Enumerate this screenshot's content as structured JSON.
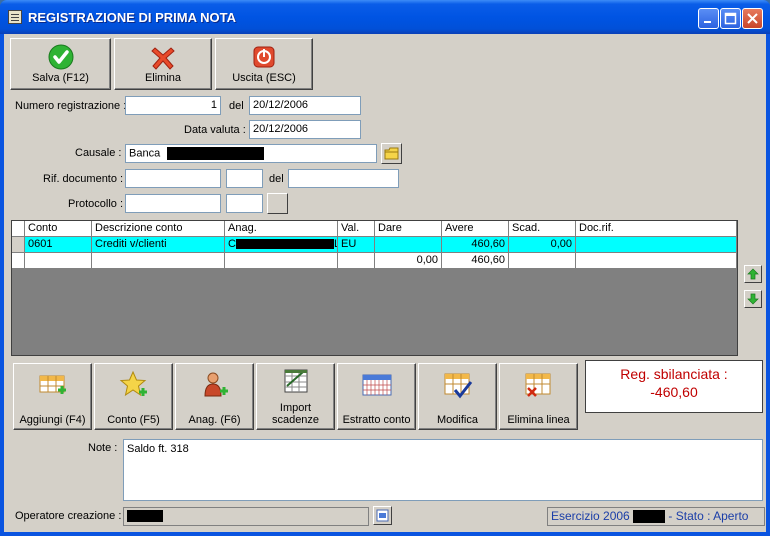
{
  "window": {
    "title": "REGISTRAZIONE DI PRIMA NOTA"
  },
  "toolbar": {
    "save_label": "Salva (F12)",
    "delete_label": "Elimina",
    "exit_label": "Uscita (ESC)"
  },
  "form": {
    "numero_label": "Numero registrazione :",
    "numero_value": "1",
    "del_label": "del",
    "del_value": "20/12/2006",
    "data_valuta_label": "Data valuta :",
    "data_valuta_value": "20/12/2006",
    "causale_label": "Causale :",
    "causale_value": "Banca",
    "rif_label": "Rif. documento :",
    "rif_value": "",
    "rif_suffix_value": "",
    "rif_del_label": "del",
    "rif_del_value": "",
    "protocollo_label": "Protocollo :",
    "protocollo_value": "",
    "protocollo_suffix_value": ""
  },
  "grid": {
    "headers": [
      "Conto",
      "Descrizione conto",
      "Anag.",
      "Val.",
      "Dare",
      "Avere",
      "Scad.",
      "Doc.rif."
    ],
    "rows": [
      {
        "conto": "0601",
        "descrizione": "Crediti v/clienti",
        "anag": "C",
        "anag_suffix": "L",
        "val": "EU",
        "dare": "",
        "avere": "460,60",
        "scad": "0,00",
        "docrif": ""
      }
    ],
    "totals": {
      "dare": "0,00",
      "avere": "460,60"
    }
  },
  "actions": {
    "aggiungi": "Aggiungi (F4)",
    "conto": "Conto (F5)",
    "anag": "Anag. (F6)",
    "import_line1": "Import",
    "import_line2": "scadenze",
    "estratto": "Estratto conto",
    "modifica": "Modifica",
    "elimina_linea": "Elimina linea"
  },
  "status": {
    "line1": "Reg. sbilanciata :",
    "line2": "-460,60"
  },
  "note": {
    "label": "Note :",
    "value": "Saldo ft. 318"
  },
  "footer": {
    "operatore_label": "Operatore creazione :",
    "esercizio_prefix": "Esercizio 2006",
    "stato_text": "- Stato : Aperto"
  },
  "colors": {
    "selected_row": "#00ffff",
    "status_text": "#c00000",
    "titlebar": "#0054e3"
  }
}
